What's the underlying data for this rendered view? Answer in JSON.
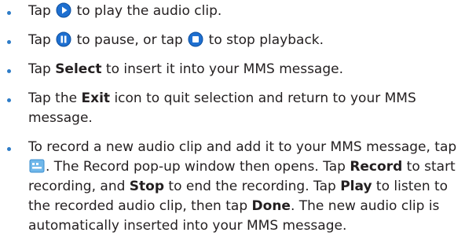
{
  "bullet_color": "#2e7cc7",
  "icon_color": "#1e6fd0",
  "items": [
    {
      "t1": "Tap ",
      "icon": "play-icon",
      "t2": " to play the audio clip."
    },
    {
      "t1": "Tap ",
      "icon1": "pause-icon",
      "t2": " to pause, or tap ",
      "icon2": "stop-icon",
      "t3": " to stop playback."
    },
    {
      "t1": "Tap ",
      "b1": "Select",
      "t2": " to insert it into your MMS message."
    },
    {
      "line1_pre": "Tap the ",
      "line1_bold": "Exit",
      "line1_post": " icon to quit selection and return to your MMS",
      "line2": "message."
    },
    {
      "l1": "To record a new audio clip and add it to your MMS message, tap",
      "l2_icon": "record-icon",
      "l2_a": ". The Record pop-up window then opens. Tap ",
      "l2_b": "Record",
      "l2_c": " to start",
      "l3_a": "recording, and ",
      "l3_b": "Stop",
      "l3_c": " to end the recording. Tap ",
      "l3_d": "Play",
      "l3_e": " to listen to",
      "l4_a": "the recorded audio clip, then tap ",
      "l4_b": "Done",
      "l4_c": ". The new audio clip is",
      "l5": "automatically inserted into your MMS message."
    }
  ]
}
